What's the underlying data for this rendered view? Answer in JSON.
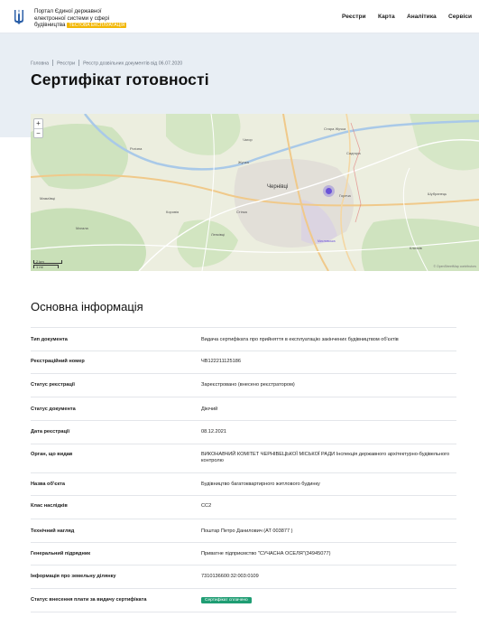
{
  "header": {
    "portal_line1": "Портал Єдиної державної",
    "portal_line2": "електронної системи у сфері",
    "portal_line3": "будівництва",
    "beta_badge": "ТЕСТОВА ЕКСПЛУАТАЦІЯ",
    "nav": [
      "Реєстри",
      "Карта",
      "Аналітика",
      "Сервіси"
    ]
  },
  "hero": {
    "breadcrumb": [
      "Головна",
      "Реєстри",
      "Реєстр дозвільних документів від 06.07.2020"
    ],
    "title": "Сертифікат готовності"
  },
  "map": {
    "zoom_in": "+",
    "zoom_out": "−",
    "scale_km": "2 km",
    "scale_mi": "1 mi",
    "labels": [
      "Чернівці",
      "Стара Жучка",
      "Садгора",
      "Рогізна",
      "Магала",
      "Мамаївці",
      "Горечa",
      "Ленківці",
      "Кличків",
      "Шубранець",
      "Коровія",
      "Чагор",
      "Жучка",
      "Мисливська",
      "Стінка"
    ],
    "attribution": "© OpenStreetMap contributors",
    "accent_color": "#6a52d8"
  },
  "section_title": "Основна інформація",
  "info_rows": [
    {
      "label": "Тип документа",
      "value": "Видача сертифіката про прийняття в експлуатацію закінчених будівництвом об'єктів"
    },
    {
      "label": "Реєстраційний номер",
      "value": "ЧВ122211125186"
    },
    {
      "label": "Статус реєстрації",
      "value": "Зареєстровано (внесено реєстратором)"
    },
    {
      "label": "Статус документа",
      "value": "Діючий"
    },
    {
      "label": "Дата реєстрації",
      "value": "08.12.2021"
    },
    {
      "label": "Орган, що видав",
      "value": "ВИКОНАВЧИЙ КОМІТЕТ ЧЕРНІВЕЦЬКОЇ МІСЬКОЇ РАДИ Інспекція державного архітектурно-будівельного контролю"
    },
    {
      "label": "Назва об'єкта",
      "value": "Будівництво багатоквартирного житлового будинку"
    },
    {
      "label": "Клас наслідків",
      "value": "СС2"
    },
    {
      "label": "Технічний нагляд",
      "value": "Поштар Петро Данилович (АТ 003877 )"
    },
    {
      "label": "Генеральний підрядник",
      "value": "Приватне підприємство \"СУЧАСНА ОСЕЛЯ\"(34945077)"
    },
    {
      "label": "Інформація про земельну ділянку",
      "value": "7310136600:32:003:0109"
    },
    {
      "label": "Статус внесення плати за видачу сертифіката",
      "value": "Сертифікат сплачено",
      "badge": true,
      "badge_color": "#1f9d73"
    }
  ]
}
